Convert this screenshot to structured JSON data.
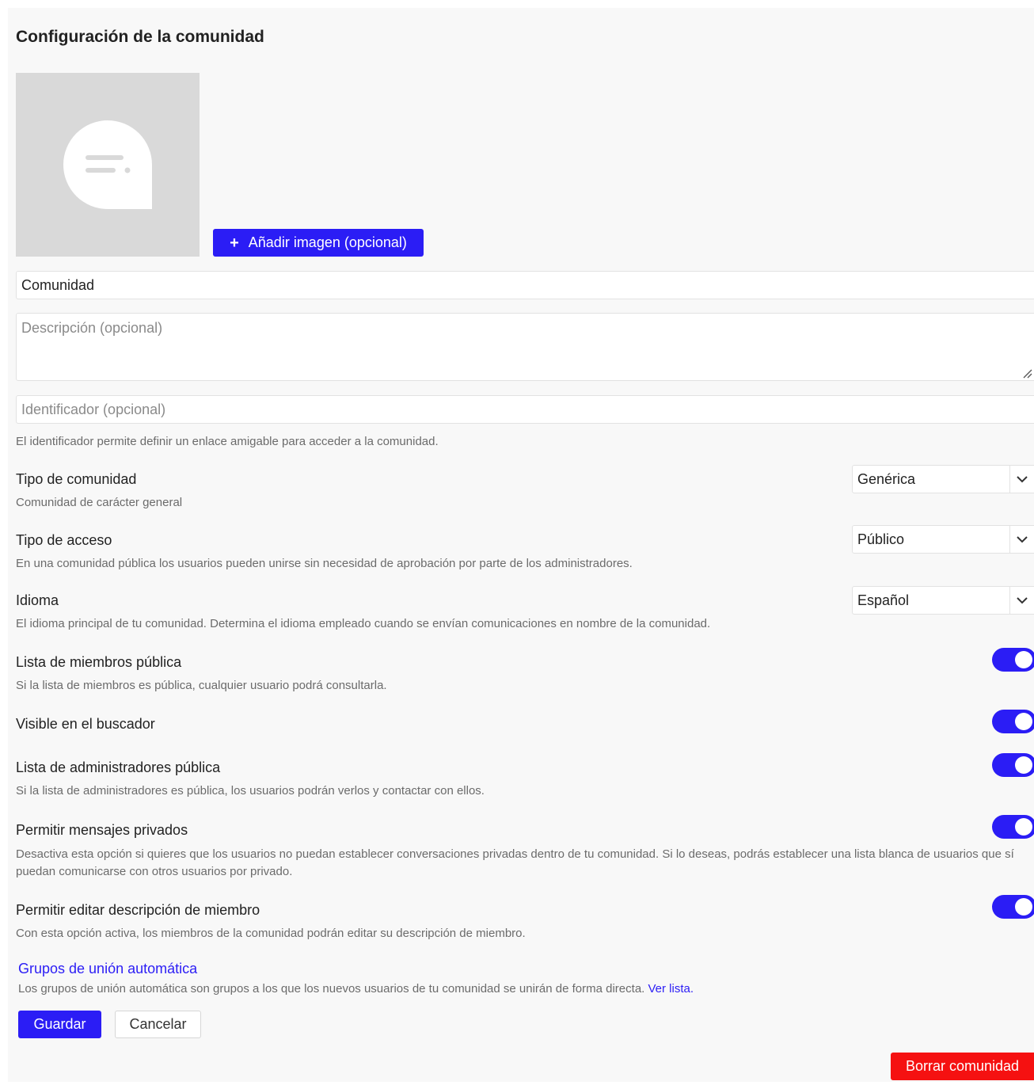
{
  "page": {
    "title": "Configuración de la comunidad"
  },
  "image": {
    "placeholder_icon": "chat-bubble-icon",
    "add_button_icon": "plus-icon",
    "add_button_label": "Añadir imagen (opcional)"
  },
  "form": {
    "name_value": "Comunidad",
    "description_placeholder": "Descripción (opcional)",
    "identifier_placeholder": "Identificador (opcional)",
    "identifier_help": "El identificador permite definir un enlace amigable para acceder a la comunidad."
  },
  "settings": {
    "community_type": {
      "label": "Tipo de comunidad",
      "help": "Comunidad de carácter general",
      "selected": "Genérica"
    },
    "access_type": {
      "label": "Tipo de acceso",
      "help": "En una comunidad pública los usuarios pueden unirse sin necesidad de aprobación por parte de los administradores.",
      "selected": "Público"
    },
    "language": {
      "label": "Idioma",
      "help": "El idioma principal de tu comunidad. Determina el idioma empleado cuando se envían comunicaciones en nombre de la comunidad.",
      "selected": "Español"
    },
    "public_members": {
      "label": "Lista de miembros pública",
      "help": "Si la lista de miembros es pública, cualquier usuario podrá consultarla.",
      "enabled": true
    },
    "search_visible": {
      "label": "Visible en el buscador",
      "enabled": true
    },
    "public_admins": {
      "label": "Lista de administradores pública",
      "help": "Si la lista de administradores es pública, los usuarios podrán verlos y contactar con ellos.",
      "enabled": true
    },
    "private_messages": {
      "label": "Permitir mensajes privados",
      "help": "Desactiva esta opción si quieres que los usuarios no puedan establecer conversaciones privadas dentro de tu comunidad. Si lo deseas, podrás establecer una lista blanca de usuarios que sí puedan comunicarse con otros usuarios por privado.",
      "enabled": true
    },
    "edit_member_description": {
      "label": "Permitir editar descripción de miembro",
      "help": "Con esta opción activa, los miembros de la comunidad podrán editar su descripción de miembro.",
      "enabled": true
    }
  },
  "autojoin": {
    "title": "Grupos de unión automática",
    "text": "Los grupos de unión automática son grupos a los que los nuevos usuarios de tu comunidad se unirán de forma directa. ",
    "link_label": "Ver lista."
  },
  "actions": {
    "save_label": "Guardar",
    "cancel_label": "Cancelar",
    "delete_label": "Borrar comunidad"
  },
  "colors": {
    "accent": "#2b1df5",
    "danger": "#f51111",
    "background": "#f8f8f8"
  }
}
